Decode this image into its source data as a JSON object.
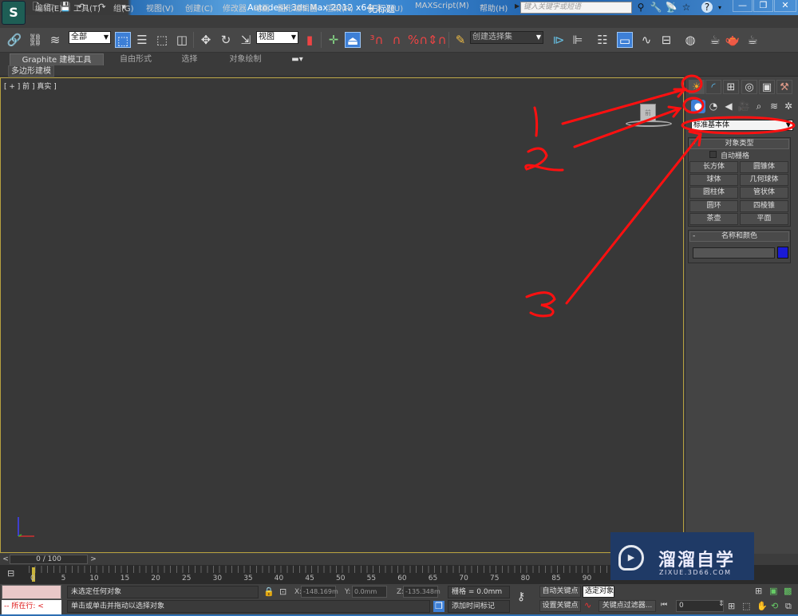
{
  "titlebar": {
    "app_title": "Autodesk 3ds Max  2012 x64",
    "document_title": "无标题",
    "search_placeholder": "键入关键字或短语",
    "quick_access": [
      "new-icon",
      "open-icon",
      "save-icon",
      "undo-icon",
      "redo-icon",
      "customize-icon"
    ],
    "window_buttons": {
      "minimize": "—",
      "restore": "❐",
      "close": "✕"
    }
  },
  "menu": [
    "编辑(E)",
    "工具(T)",
    "组(G)",
    "视图(V)",
    "创建(C)",
    "修改器",
    "动画",
    "图形编辑器",
    "渲染(R)",
    "自定义(U)",
    "MAXScript(M)",
    "帮助(H)"
  ],
  "toolbar": {
    "selection_filter": "全部",
    "reference_coord": "视图",
    "named_selection_set": "创建选择集"
  },
  "ribbon": {
    "tabs": [
      "Graphite 建模工具",
      "自由形式",
      "选择",
      "对象绘制"
    ],
    "active_tab": "Graphite 建模工具",
    "sub_label": "多边形建模"
  },
  "viewport": {
    "label": "[ + ] 前 ] 真实 ]",
    "viewcube_face": "前"
  },
  "command_panel": {
    "category": "标准基本体",
    "object_type_title": "对象类型",
    "autogrid_label": "自动栅格",
    "autogrid_checked": false,
    "object_buttons": [
      "长方体",
      "圆锥体",
      "球体",
      "几何球体",
      "圆柱体",
      "管状体",
      "圆环",
      "四棱锥",
      "茶壶",
      "平面"
    ],
    "name_color_title": "名称和颜色",
    "object_name": "",
    "object_color": "#1a1ad6"
  },
  "annotations": [
    "1",
    "2",
    "3"
  ],
  "timeline": {
    "frame_display": "0 / 100",
    "current_frame": 0,
    "total_frames": 100,
    "tick_labels": [
      "0",
      "5",
      "10",
      "15",
      "20",
      "25",
      "30",
      "35",
      "40",
      "45",
      "50",
      "55",
      "60",
      "65",
      "70",
      "75",
      "80",
      "85",
      "90"
    ]
  },
  "status": {
    "maxscript_prompt": "--  所在行:  <",
    "selection_status": "未选定任何对象",
    "prompt": "单击或单击并拖动以选择对象",
    "x_label": "X:",
    "x_value": "-148.169m",
    "y_label": "Y:",
    "y_value": "0.0mm",
    "z_label": "Z:",
    "z_value": "-135.348m",
    "grid": "栅格 = 0.0mm",
    "add_time_tag": "添加时间标记",
    "auto_key": "自动关键点",
    "set_key": "设置关键点",
    "selected_option": "选定对象",
    "key_filters": "关键点过滤器...",
    "frame_value": "0"
  },
  "watermark": {
    "title": "溜溜自学",
    "url": "ZIXUE.3D66.COM"
  }
}
